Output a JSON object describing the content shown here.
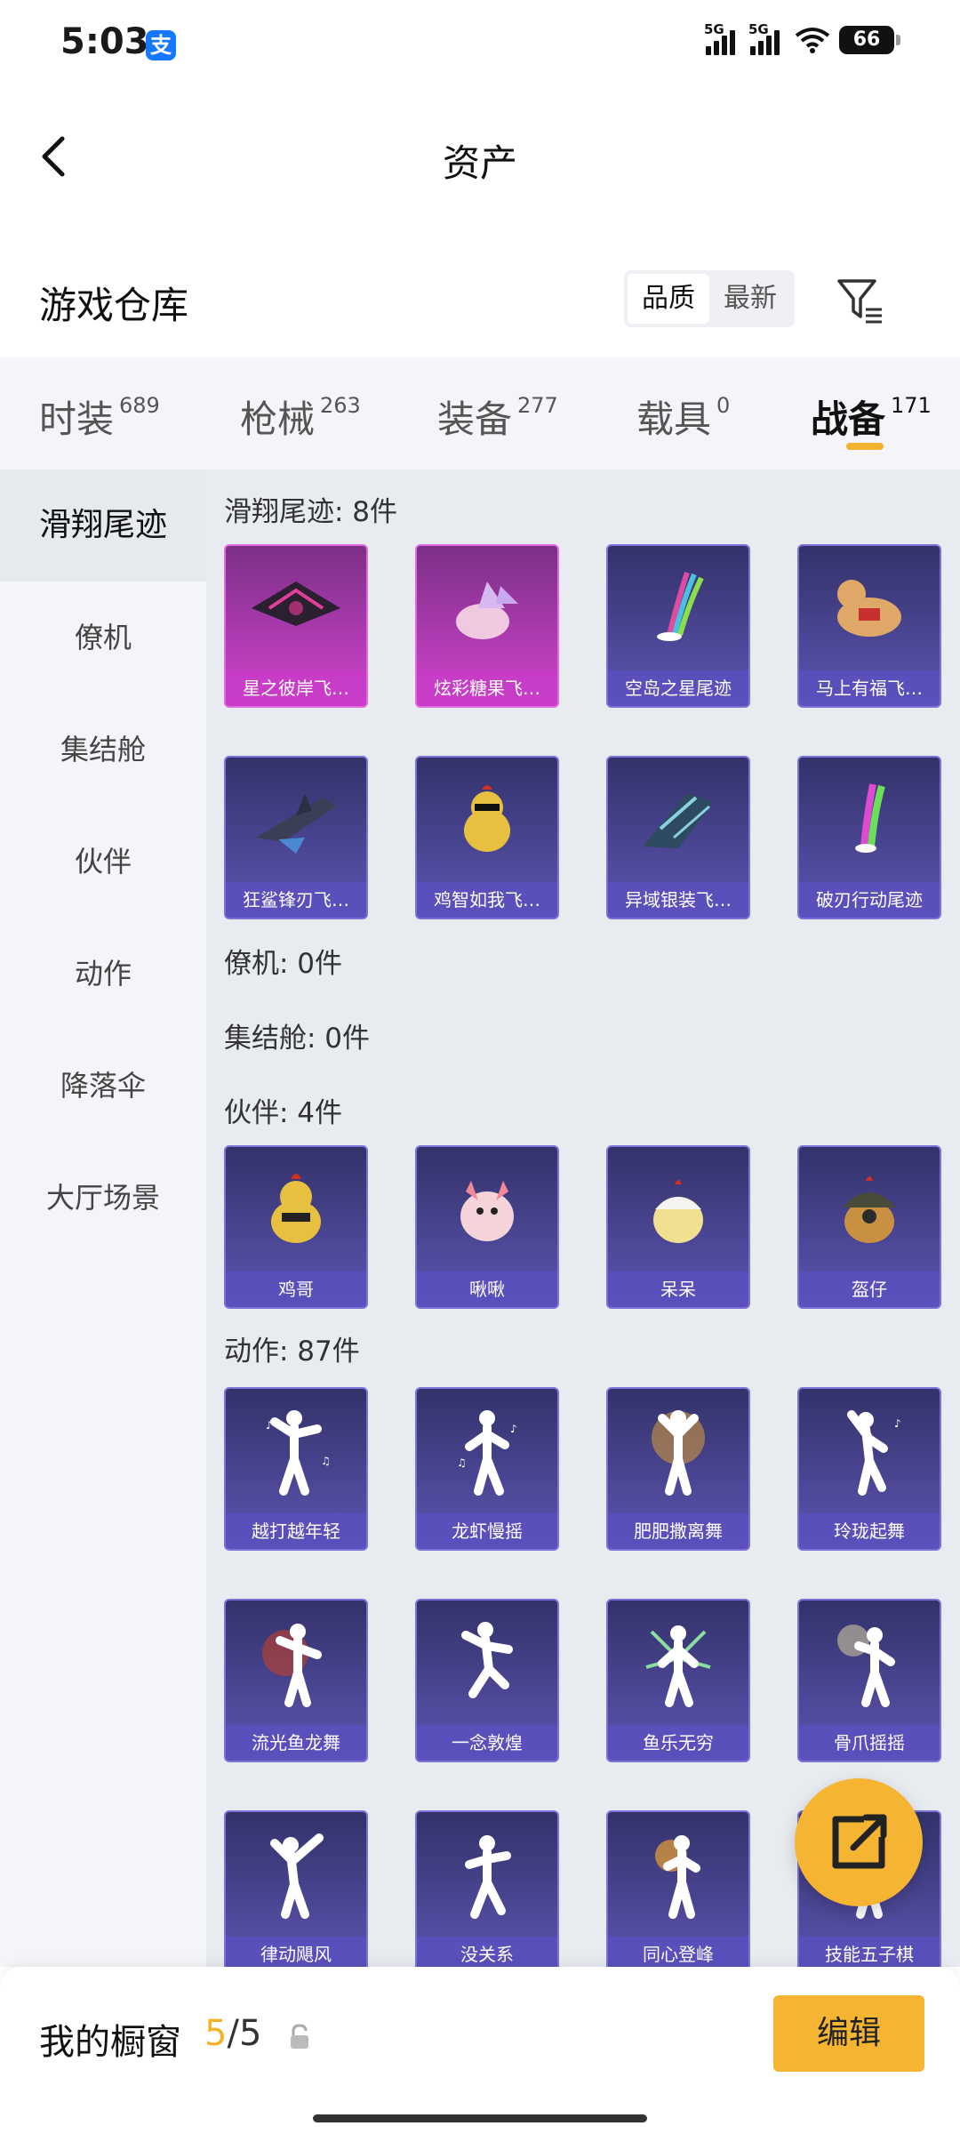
{
  "status": {
    "time": "5:03",
    "battery": "66",
    "signal1": "5G",
    "signal2": "5G",
    "alipay": "支"
  },
  "header": {
    "title": "资产"
  },
  "repo": {
    "title": "游戏仓库",
    "sort_quality": "品质",
    "sort_latest": "最新"
  },
  "tabs": [
    {
      "name": "时装",
      "count": "689"
    },
    {
      "name": "枪械",
      "count": "263"
    },
    {
      "name": "装备",
      "count": "277"
    },
    {
      "name": "载具",
      "count": "0"
    },
    {
      "name": "战备",
      "count": "171"
    }
  ],
  "sidebar": [
    "滑翔尾迹",
    "僚机",
    "集结舱",
    "伙伴",
    "动作",
    "降落伞",
    "大厅场景"
  ],
  "sections": {
    "glide": {
      "title": "滑翔尾迹: 8件",
      "items": [
        "星之彼岸飞…",
        "炫彩糖果飞…",
        "空岛之星尾迹",
        "马上有福飞…",
        "狂鲨锋刃飞…",
        "鸡智如我飞…",
        "异域银装飞…",
        "破刃行动尾迹"
      ]
    },
    "wingman": {
      "title": "僚机: 0件"
    },
    "pod": {
      "title": "集结舱: 0件"
    },
    "partner": {
      "title": "伙伴: 4件",
      "items": [
        "鸡哥",
        "啾啾",
        "呆呆",
        "盔仔"
      ]
    },
    "emote": {
      "title": "动作: 87件",
      "items": [
        "越打越年轻",
        "龙虾慢摇",
        "肥肥撒离舞",
        "玲珑起舞",
        "流光鱼龙舞",
        "一念敦煌",
        "鱼乐无穷",
        "骨爪摇摇",
        "律动飓风",
        "没关系",
        "同心登峰",
        "技能五子棋"
      ]
    }
  },
  "bottom": {
    "showcase_label": "我的橱窗",
    "current": "5",
    "sep": "/",
    "total": "5",
    "edit": "编辑"
  },
  "colors": {
    "accent": "#f5b533",
    "card_purple": "#4a4592",
    "card_pink": "#b03bb3"
  },
  "icons": [
    "back-arrow-icon",
    "filter-icon",
    "lock-icon",
    "share-icon",
    "wifi-icon"
  ]
}
